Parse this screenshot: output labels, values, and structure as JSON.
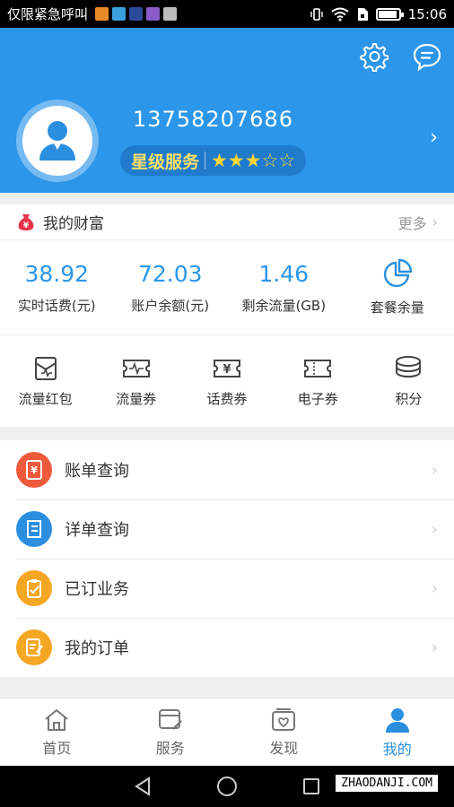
{
  "status_bar": {
    "left_text": "仅限紧急呼叫",
    "time": "15:06"
  },
  "header": {
    "phone": "13758207686",
    "star_label": "星级服务",
    "stars_filled": 3,
    "stars_total": 5,
    "stars_glyphs": "★★★☆☆"
  },
  "wealth": {
    "title": "我的财富",
    "more": "更多",
    "stats": [
      {
        "value": "38.92",
        "label": "实时话费(元)"
      },
      {
        "value": "72.03",
        "label": "账户余额(元)"
      },
      {
        "value": "1.46",
        "label": "剩余流量(GB)"
      },
      {
        "value": "",
        "label": "套餐余量"
      }
    ],
    "tiles": [
      {
        "label": "流量红包"
      },
      {
        "label": "流量券"
      },
      {
        "label": "话费券"
      },
      {
        "label": "电子券"
      },
      {
        "label": "积分"
      }
    ]
  },
  "menu": [
    {
      "label": "账单查询",
      "color": "#f05a3c"
    },
    {
      "label": "详单查询",
      "color": "#2b8fe0"
    },
    {
      "label": "已订业务",
      "color": "#f5a623"
    },
    {
      "label": "我的订单",
      "color": "#f5a623"
    }
  ],
  "tabs": [
    {
      "label": "首页"
    },
    {
      "label": "服务"
    },
    {
      "label": "发现"
    },
    {
      "label": "我的"
    }
  ],
  "watermark": "ZHAODANJI.COM",
  "colors": {
    "header_bg": "#2b96ea",
    "accent": "#2b8fe0",
    "star": "#ffd633"
  }
}
